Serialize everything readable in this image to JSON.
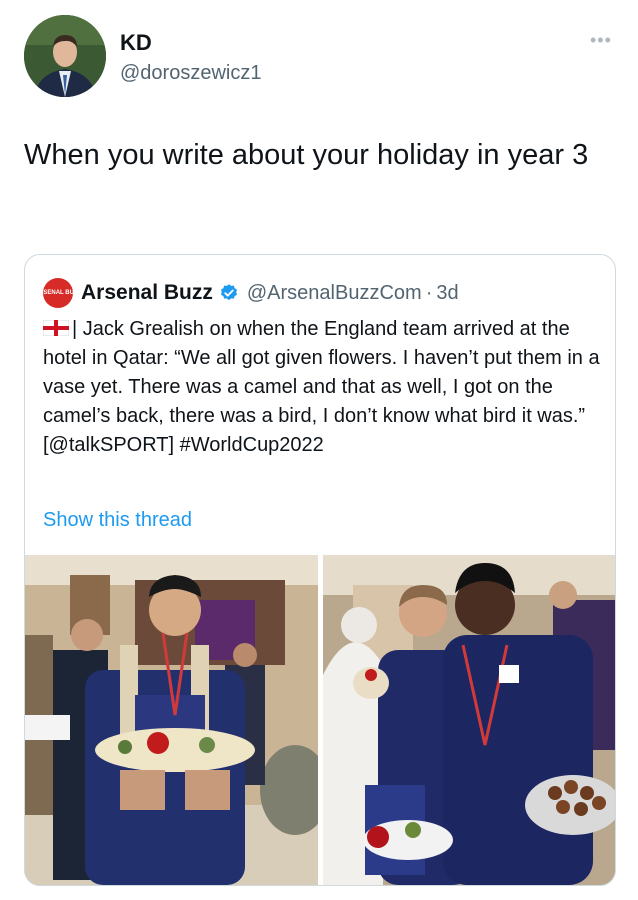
{
  "author": {
    "name": "KD",
    "handle": "@doroszewicz1",
    "more_icon": "ellipsis-icon"
  },
  "tweet_text": "When you write about your holiday in year 3",
  "quoted": {
    "name": "Arsenal Buzz",
    "logo_text": "ARSENAL BUZZ",
    "handle": "@ArsenalBuzzCom",
    "separator": "·",
    "time": "3d",
    "body": "| Jack Grealish on when the England team arrived at the hotel in Qatar: “We all got given flowers. I haven’t put them in a vase yet. There was a camel and that as well, I got on the camel’s back, there was a bird, I don’t know what bird it was.” [@talkSPORT] #WorldCup2022",
    "show_thread": "Show this thread",
    "colors": {
      "link": "#1d9bf0",
      "verified": "#1d9bf0",
      "logo": "#d62b27"
    }
  }
}
